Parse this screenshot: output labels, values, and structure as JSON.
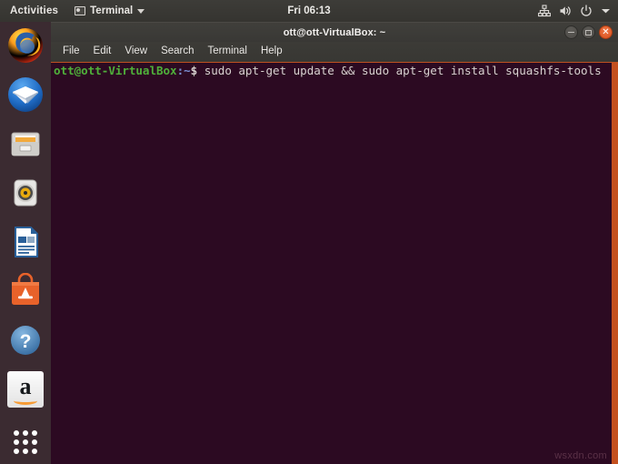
{
  "topbar": {
    "activities_label": "Activities",
    "app_menu_label": "Terminal",
    "app_menu_icon": "window-icon",
    "app_menu_caret_icon": "chevron-down-icon",
    "clock": "Fri 06:13",
    "indicators": [
      {
        "name": "network-icon",
        "label": "Network"
      },
      {
        "name": "volume-icon",
        "label": "Volume"
      },
      {
        "name": "power-icon",
        "label": "Power"
      },
      {
        "name": "chevron-down-icon",
        "label": "System menu"
      }
    ]
  },
  "launcher": {
    "items": [
      {
        "name": "firefox",
        "label": "Firefox Web Browser",
        "icon": "firefox-icon"
      },
      {
        "name": "thunderbird",
        "label": "Thunderbird Mail",
        "icon": "thunderbird-icon"
      },
      {
        "name": "files",
        "label": "Files",
        "icon": "files-icon"
      },
      {
        "name": "rhythmbox",
        "label": "Rhythmbox",
        "icon": "rhythmbox-icon"
      },
      {
        "name": "libreoffice-writer",
        "label": "LibreOffice Writer",
        "icon": "libreoffice-writer-icon"
      },
      {
        "name": "ubuntu-software",
        "label": "Ubuntu Software",
        "icon": "ubuntu-software-icon"
      },
      {
        "name": "help",
        "label": "Help",
        "icon": "help-icon"
      },
      {
        "name": "amazon",
        "label": "Amazon",
        "icon": "amazon-icon"
      },
      {
        "name": "show-applications",
        "label": "Show Applications",
        "icon": "apps-grid-icon"
      }
    ]
  },
  "window": {
    "title": "ott@ott-VirtualBox: ~",
    "controls": {
      "minimize": "minimize-button",
      "maximize": "maximize-button",
      "close": "close-button"
    },
    "menu": [
      {
        "label": "File"
      },
      {
        "label": "Edit"
      },
      {
        "label": "View"
      },
      {
        "label": "Search"
      },
      {
        "label": "Terminal"
      },
      {
        "label": "Help"
      }
    ]
  },
  "terminal": {
    "prompt_user_host": "ott@ott-VirtualBox",
    "prompt_path": ":~",
    "prompt_symbol": "$ ",
    "command": "sudo apt-get update && sudo apt-get install squashfs-tools",
    "colors": {
      "background": "#2c0a22",
      "foreground": "#d8d2d0",
      "prompt_green": "#4fb03a",
      "prompt_blue": "#7b8fd4",
      "scrollbar_orange": "#c4501f"
    }
  },
  "watermark": "wsxdn.com"
}
